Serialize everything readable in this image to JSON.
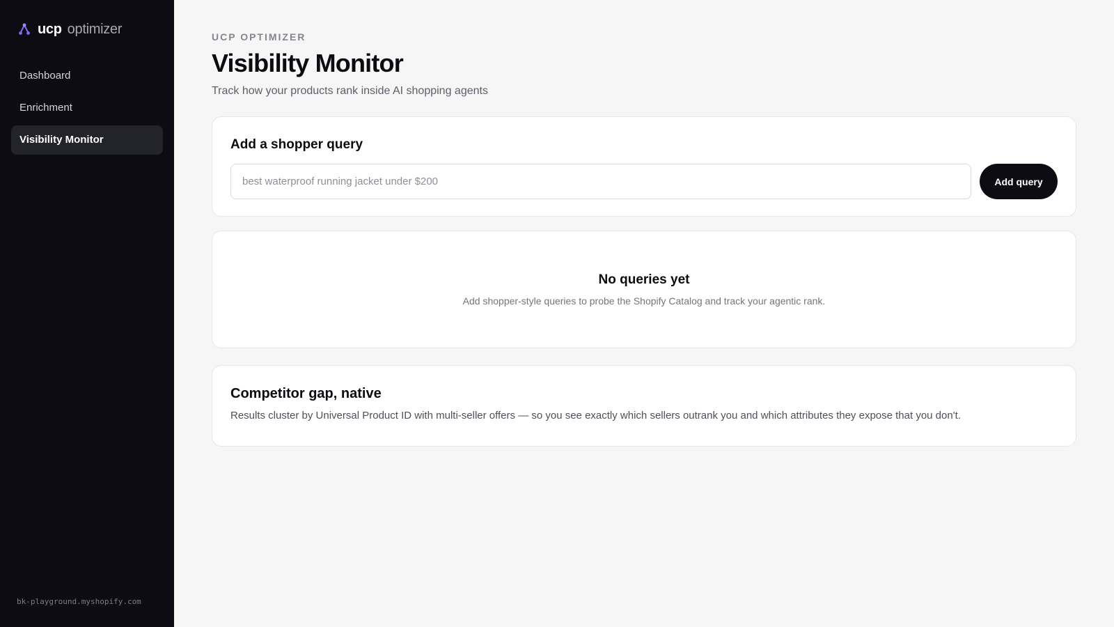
{
  "brand": {
    "name": "ucp",
    "sub": "optimizer",
    "icon": "agent-nodes-icon",
    "accent": "#7c6cf0"
  },
  "sidebar": {
    "items": [
      {
        "label": "Dashboard",
        "active": false
      },
      {
        "label": "Enrichment",
        "active": false
      },
      {
        "label": "Visibility Monitor",
        "active": true
      }
    ],
    "shop_domain": "bk-playground.myshopify.com"
  },
  "header": {
    "eyebrow": "UCP OPTIMIZER",
    "title": "Visibility Monitor",
    "subtitle": "Track how your products rank inside AI shopping agents"
  },
  "add_query": {
    "title": "Add a shopper query",
    "placeholder": "best waterproof running jacket under $200",
    "value": "",
    "button_label": "Add query"
  },
  "empty_state": {
    "title": "No queries yet",
    "text": "Add shopper-style queries to probe the Shopify Catalog and track your agentic rank."
  },
  "competitor_gap": {
    "title": "Competitor gap, native",
    "text": "Results cluster by Universal Product ID with multi-seller offers — so you see exactly which sellers outrank you and which attributes they expose that you don't."
  }
}
